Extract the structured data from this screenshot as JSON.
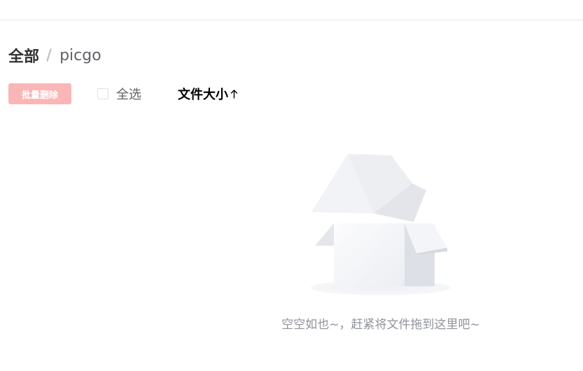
{
  "breadcrumb": {
    "root": "全部",
    "separator": "/",
    "current": "picgo"
  },
  "toolbar": {
    "batch_delete_label": "批量删除",
    "batch_delete_disabled": true,
    "select_all_label": "全选",
    "select_all_checked": false,
    "sort_label": "文件大小",
    "sort_direction_icon": "arrow-up-icon"
  },
  "empty_state": {
    "illustration_icon": "empty-box-icon",
    "text": "空空如也~，赶紧将文件拖到这里吧~"
  },
  "colors": {
    "danger_disabled": "#fab6b6",
    "text_primary": "#303133",
    "text_regular": "#606266",
    "text_secondary": "#909399",
    "border": "#dcdfe6"
  }
}
